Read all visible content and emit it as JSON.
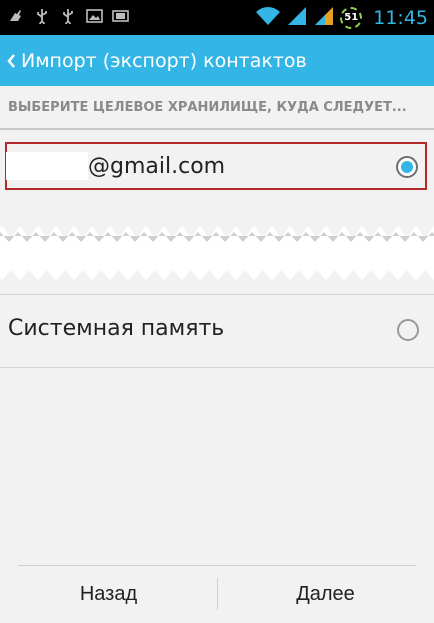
{
  "status_bar": {
    "time": "11:45",
    "battery_level": "51",
    "left_icons": [
      "cleaner-icon",
      "usb-icon",
      "usb-icon",
      "image-icon",
      "sd-card-icon"
    ],
    "accent_color": "#33b5e5"
  },
  "action_bar": {
    "title": "Импорт (экспорт) контактов",
    "color": "#33b5e5"
  },
  "section_header": "ВЫБЕРИТЕ ЦЕЛЕВОЕ ХРАНИЛИЩЕ, КУДА СЛЕДУЕТ...",
  "options": [
    {
      "label": "@gmail.com",
      "selected": true
    },
    {
      "label": "Системная память",
      "selected": false
    }
  ],
  "buttons": {
    "back": "Назад",
    "next": "Далее"
  }
}
